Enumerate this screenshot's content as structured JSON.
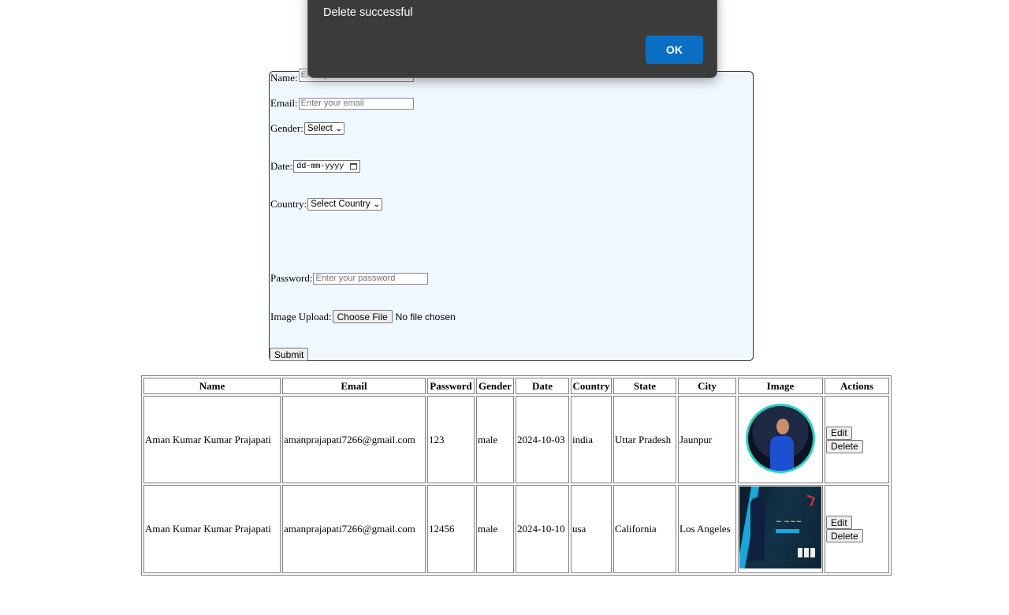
{
  "dialog": {
    "message": "Delete successful",
    "ok_label": "OK"
  },
  "form": {
    "name_label": "Name:",
    "name_placeholder": "Enter your name",
    "email_label": "Email:",
    "email_placeholder": "Enter your email",
    "gender_label": "Gender:",
    "gender_value": "Select",
    "date_label": "Date:",
    "date_placeholder": "dd-mm-yyyy",
    "country_label": "Country:",
    "country_value": "Select Country",
    "password_label": "Password:",
    "password_placeholder": "Enter your password",
    "image_label": "Image Upload:",
    "choose_file_label": "Choose File",
    "no_file_text": "No file chosen",
    "submit_label": "Submit"
  },
  "table": {
    "headers": [
      "Name",
      "Email",
      "Password",
      "Gender",
      "Date",
      "Country",
      "State",
      "City",
      "Image",
      "Actions"
    ],
    "rows": [
      {
        "name": "Aman Kumar Kumar Prajapati",
        "email": "amanprajapati7266@gmail.com",
        "password": "123",
        "gender": "male",
        "date": "2024-10-03",
        "country": "india",
        "state": "Uttar Pradesh",
        "city": "Jaunpur",
        "image": "profile-photo",
        "edit_label": "Edit",
        "delete_label": "Delete"
      },
      {
        "name": "Aman Kumar Kumar Prajapati",
        "email": "amanprajapati7266@gmail.com",
        "password": "12456",
        "gender": "male",
        "date": "2024-10-10",
        "country": "usa",
        "state": "California",
        "city": "Los Angeles",
        "image": "banner-photo",
        "edit_label": "Edit",
        "delete_label": "Delete"
      }
    ]
  },
  "colors": {
    "form_background": "#f0f8ff",
    "dialog_background": "#3b3b3b",
    "ok_button": "#0a6fc2"
  }
}
